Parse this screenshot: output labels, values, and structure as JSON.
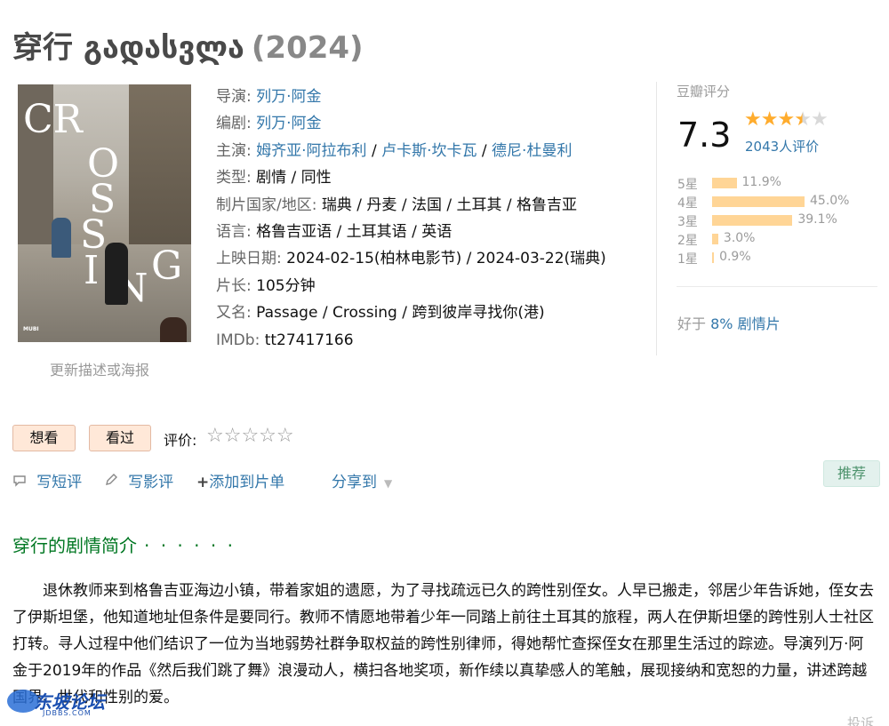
{
  "title": {
    "name": "穿行 გადასვლა",
    "year": "(2024)"
  },
  "poster": {
    "title_letters": [
      "CR",
      "O",
      "S",
      "S",
      "I",
      "N",
      "G"
    ],
    "studio": "MUBI",
    "update_link": "更新描述或海报"
  },
  "info": {
    "director_label": "导演:",
    "director": "列万·阿金",
    "writer_label": "编剧:",
    "writer": "列万·阿金",
    "cast_label": "主演:",
    "cast": [
      "姆齐亚·阿拉布利",
      "卢卡斯·坎卡瓦",
      "德尼·杜曼利"
    ],
    "cast_sep": " / ",
    "genre_label": "类型:",
    "genre": "剧情 / 同性",
    "country_label": "制片国家/地区:",
    "country": "瑞典 / 丹麦 / 法国 / 土耳其 / 格鲁吉亚",
    "language_label": "语言:",
    "language": "格鲁吉亚语 / 土耳其语 / 英语",
    "release_label": "上映日期:",
    "release": "2024-02-15(柏林电影节) / 2024-03-22(瑞典)",
    "runtime_label": "片长:",
    "runtime": "105分钟",
    "aka_label": "又名:",
    "aka": "Passage / Crossing / 跨到彼岸寻找你(港)",
    "imdb_label": "IMDb:",
    "imdb": "tt27417166"
  },
  "rating": {
    "label": "豆瓣评分",
    "score": "7.3",
    "stars_value": 3.5,
    "star_full": "★",
    "star_half": "★",
    "star_empty": "★",
    "count": "2043人评价",
    "histogram": [
      {
        "label": "5星",
        "pct": "11.9%",
        "value": 11.9
      },
      {
        "label": "4星",
        "pct": "45.0%",
        "value": 45.0
      },
      {
        "label": "3星",
        "pct": "39.1%",
        "value": 39.1
      },
      {
        "label": "2星",
        "pct": "3.0%",
        "value": 3.0
      },
      {
        "label": "1星",
        "pct": "0.9%",
        "value": 0.9
      }
    ],
    "better_prefix": "好于 ",
    "better_link": "8% 剧情片"
  },
  "actions": {
    "want": "想看",
    "seen": "看过",
    "rate_label": "评价:",
    "rate_stars": "☆☆☆☆☆",
    "short_review": "写短评",
    "review": "写影评",
    "add_list": "添加到片单",
    "add_plus": "+",
    "share": "分享到",
    "recommend": "推荐"
  },
  "synopsis": {
    "title": "穿行的剧情简介",
    "dots": "· · · · · ·",
    "text": "退休教师来到格鲁吉亚海边小镇，带着家姐的遗愿，为了寻找疏远已久的跨性别侄女。人早已搬走，邻居少年告诉她，侄女去了伊斯坦堡，他知道地址但条件是要同行。教师不情愿地带着少年一同踏上前往土耳其的旅程，两人在伊斯坦堡的跨性别人士社区打转。寻人过程中他们结识了一位为当地弱势社群争取权益的跨性别律师，得她帮忙查探侄女在那里生活过的踪迹。导演列万·阿金于2019年的作品《然后我们跳了舞》浪漫动人，横扫各地奖项，新作续以真挚感人的笔触，展现接纳和宽恕的力量，讲述跨越国界、世代和性别的爱。"
  },
  "watermark": {
    "text": "东坡论坛",
    "sub": "JDBBS.COM"
  },
  "report": "投诉",
  "colors": {
    "link": "#3377aa",
    "green": "#007722",
    "star": "#ffac2d",
    "bar": "#ffd596"
  }
}
